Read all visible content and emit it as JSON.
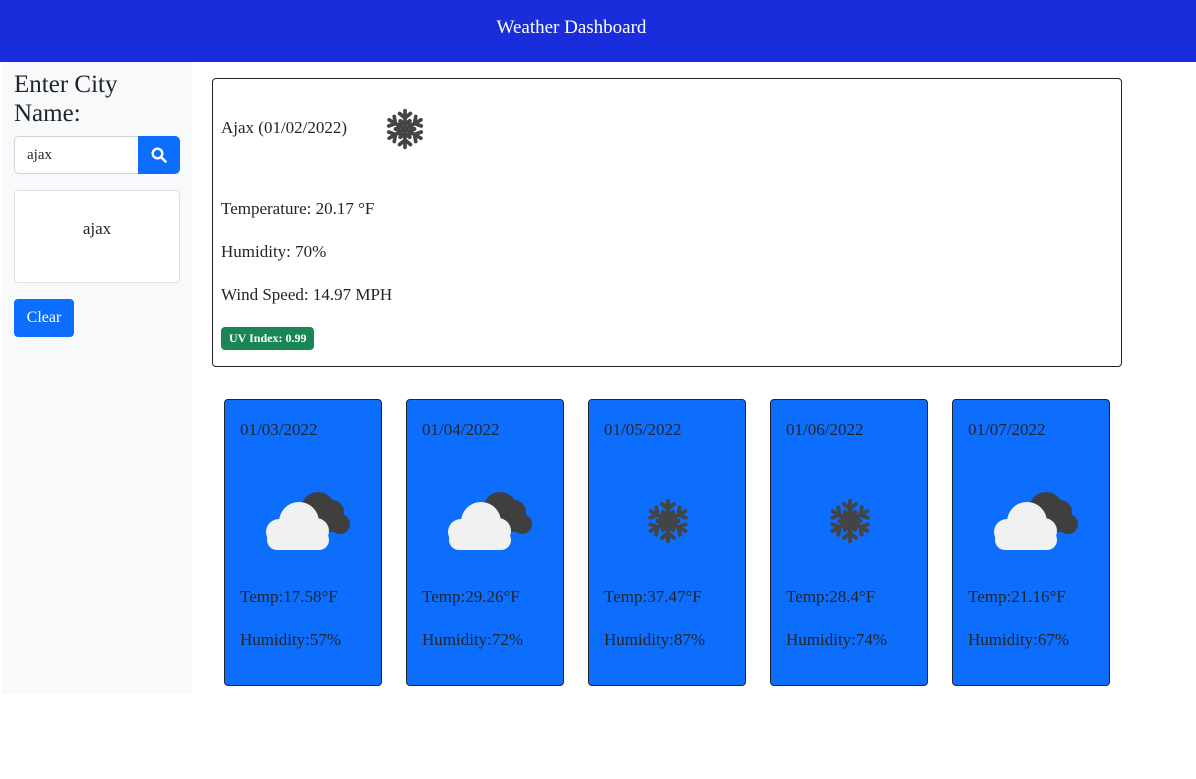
{
  "header": {
    "title": "Weather Dashboard"
  },
  "sidebar": {
    "label": "Enter City Name:",
    "search": {
      "value": "ajax",
      "placeholder": "",
      "button_icon": "search-icon"
    },
    "history": [
      "ajax"
    ],
    "clear_label": "Clear"
  },
  "current": {
    "title": "Ajax (01/02/2022)",
    "icon": "snowflake-icon",
    "temperature": "Temperature: 20.17 °F",
    "humidity": "Humidity: 70%",
    "wind": "Wind Speed: 14.97 MPH",
    "uv": "UV Index: 0.99",
    "uv_color": "#198754"
  },
  "forecast": [
    {
      "date": "01/03/2022",
      "icon": "cloud-icon",
      "temp": "Temp:17.58°F",
      "humidity": "Humidity:57%"
    },
    {
      "date": "01/04/2022",
      "icon": "cloud-icon",
      "temp": "Temp:29.26°F",
      "humidity": "Humidity:72%"
    },
    {
      "date": "01/05/2022",
      "icon": "snowflake-icon",
      "temp": "Temp:37.47°F",
      "humidity": "Humidity:87%"
    },
    {
      "date": "01/06/2022",
      "icon": "snowflake-icon",
      "temp": "Temp:28.4°F",
      "humidity": "Humidity:74%"
    },
    {
      "date": "01/07/2022",
      "icon": "cloud-icon",
      "temp": "Temp:21.16°F",
      "humidity": "Humidity:67%"
    }
  ],
  "colors": {
    "navbar": "#1a2ddd",
    "primary": "#0d6efd",
    "sidebar_bg": "#f8f9fa"
  }
}
